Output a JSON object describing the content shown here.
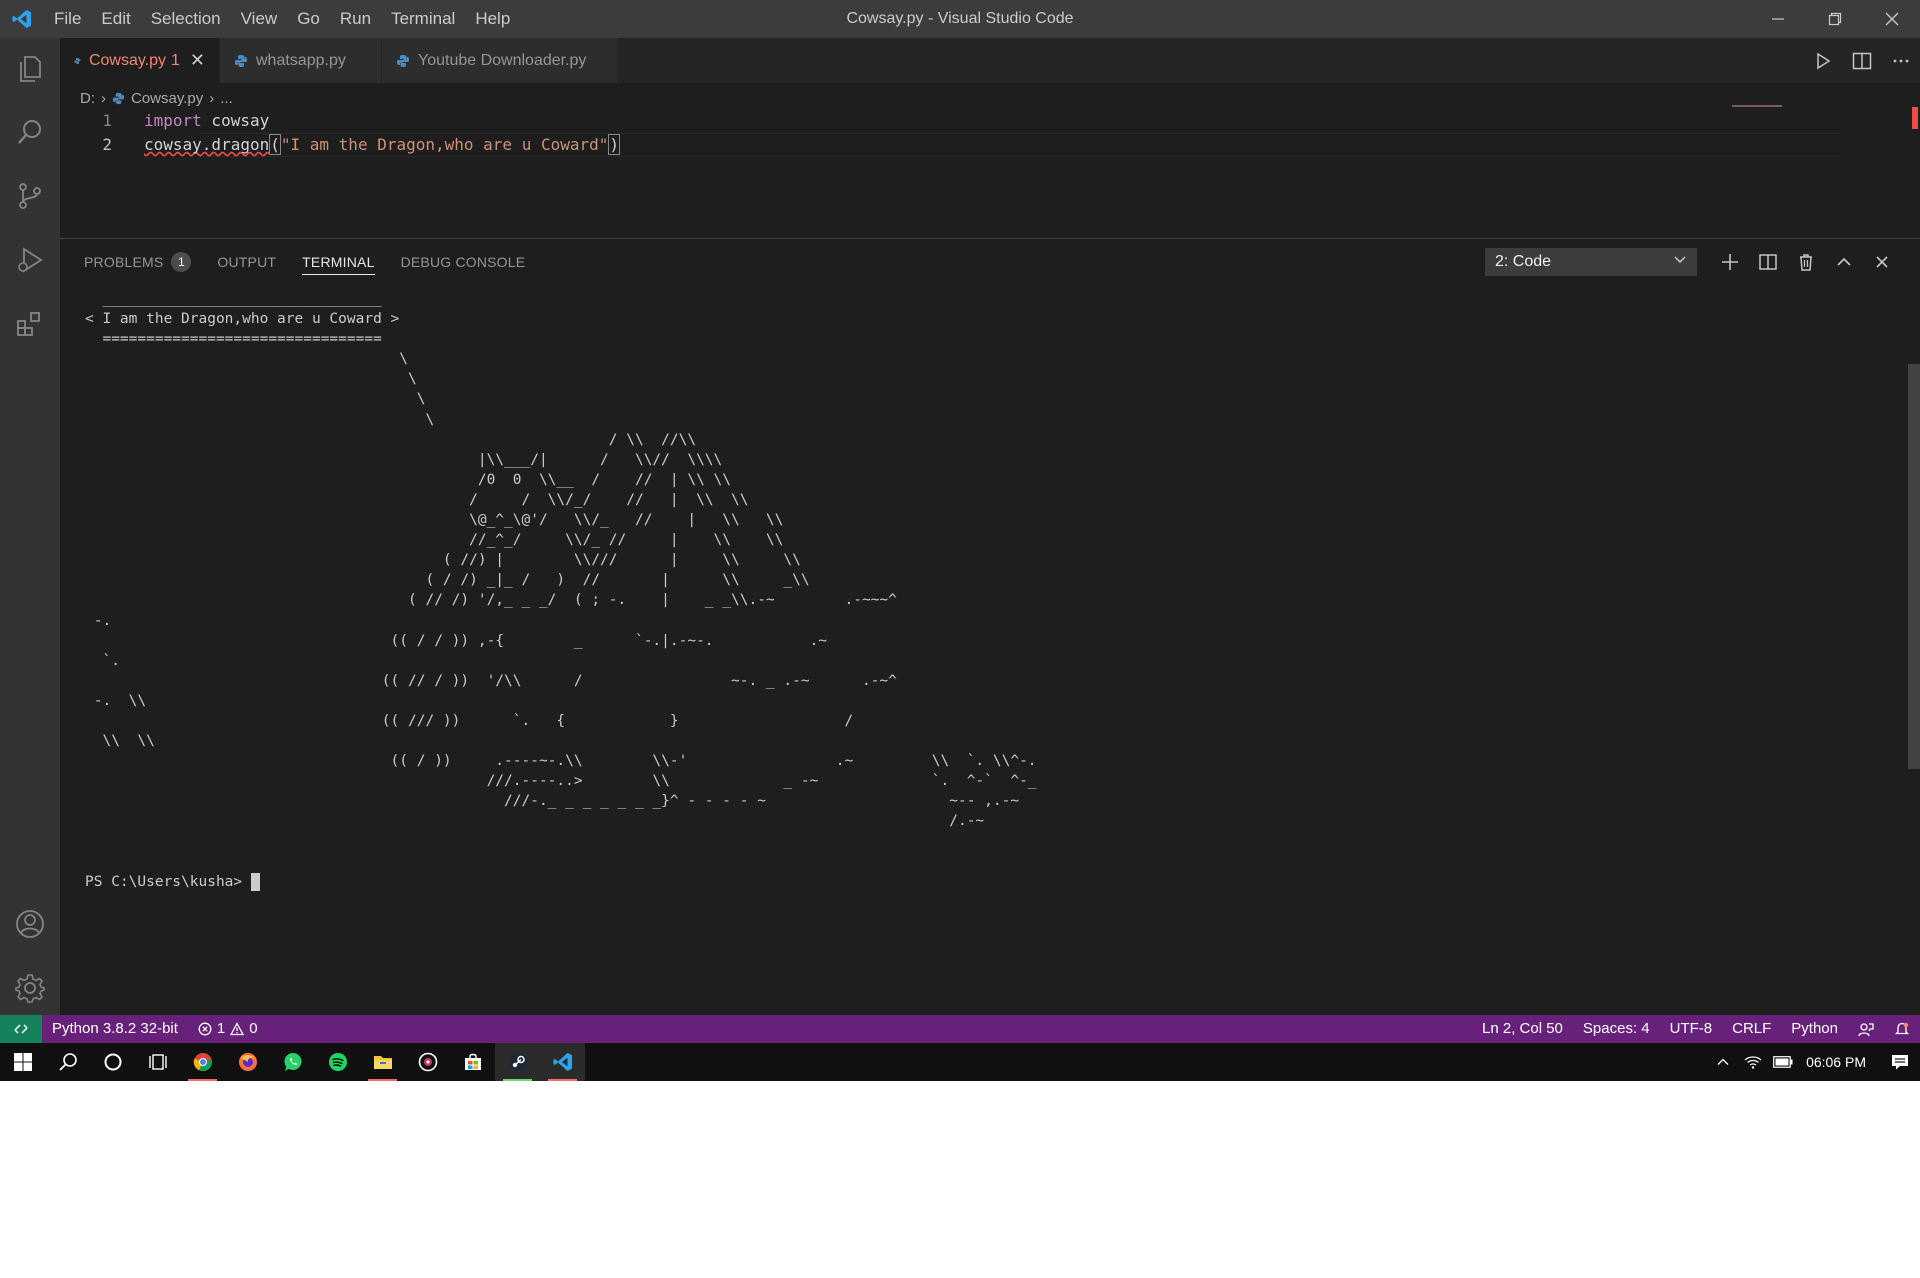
{
  "window": {
    "title": "Cowsay.py - Visual Studio Code",
    "menu": [
      "File",
      "Edit",
      "Selection",
      "View",
      "Go",
      "Run",
      "Terminal",
      "Help"
    ]
  },
  "tabs": [
    {
      "label": "Cowsay.py",
      "problems": "1",
      "active": true
    },
    {
      "label": "whatsapp.py",
      "active": false
    },
    {
      "label": "Youtube Downloader.py",
      "active": false
    }
  ],
  "breadcrumb": {
    "drive": "D:",
    "file": "Cowsay.py",
    "more": "..."
  },
  "code": {
    "lines": [
      {
        "number": "1",
        "keyword": "import",
        "rest": " cowsay"
      },
      {
        "number": "2",
        "call": "cowsay.dragon",
        "open": "(",
        "string": "\"I am the Dragon,who are u Coward\"",
        "close": ")"
      }
    ]
  },
  "panel": {
    "tabs": {
      "problems": "PROBLEMS",
      "problems_count": "1",
      "output": "OUTPUT",
      "terminal": "TERMINAL",
      "debug": "DEBUG CONSOLE"
    },
    "terminal_selector": "2: Code",
    "terminal_output": "  ________________________________\n< I am the Dragon,who are u Coward >\n  ================================\n                                    \\\n                                     \\\n                                      \\\n                                       \\\n                                                            / \\\\  //\\\\\n                                             |\\\\___/|      /   \\\\//  \\\\\\\\\n                                             /0  0  \\\\__  /    //  | \\\\ \\\\\n                                            /     /  \\\\/_/    //   |  \\\\  \\\\\n                                            \\@_^_\\@'/   \\\\/_   //    |   \\\\   \\\\\n                                            //_^_/     \\\\/_ //     |    \\\\    \\\\\n                                         ( //) |        \\\\///      |     \\\\     \\\\\n                                       ( / /) _|_ /   )  //       |      \\\\     _\\\\\n                                     ( // /) '/,_ _ _/  ( ; -.    |    _ _\\\\.-~        .-~~~^\n -.\n                                   (( / / )) ,-{        _      `-.|.-~-.           .~\n  `.\n                                  (( // / ))  '/\\\\      /                 ~-. _ .-~      .-~^\n -.  \\\\\n                                  (( /// ))      `.   {            }                   /\n  \\\\  \\\\\n                                   (( / ))     .----~-.\\\\        \\\\-'                 .~         \\\\  `. \\\\^-.\n                                              ///.----..>        \\\\             _ -~             `.  ^-`  ^-_\n                                                ///-._ _ _ _ _ _ _}^ - - - - ~                     ~-- ,.-~\n                                                                                                   /.-~\n\n\n",
    "prompt": "PS C:\\Users\\kusha> "
  },
  "statusbar": {
    "python": "Python 3.8.2 32-bit",
    "errors": "1",
    "warnings": "0",
    "position": "Ln 2, Col 50",
    "spaces": "Spaces: 4",
    "encoding": "UTF-8",
    "eol": "CRLF",
    "language": "Python"
  },
  "taskbar": {
    "time": "06:06 PM",
    "apps": [
      "windows-start",
      "search",
      "cortana",
      "task-view",
      "chrome",
      "firefox",
      "whatsapp",
      "spotify",
      "file-explorer",
      "groove-music",
      "store",
      "steam",
      "vscode"
    ]
  },
  "colors": {
    "statusbar": "#68217a",
    "remote": "#16825d",
    "editor_bg": "#1e1e1e",
    "error_tab": "#f48771",
    "string": "#ce9178"
  }
}
